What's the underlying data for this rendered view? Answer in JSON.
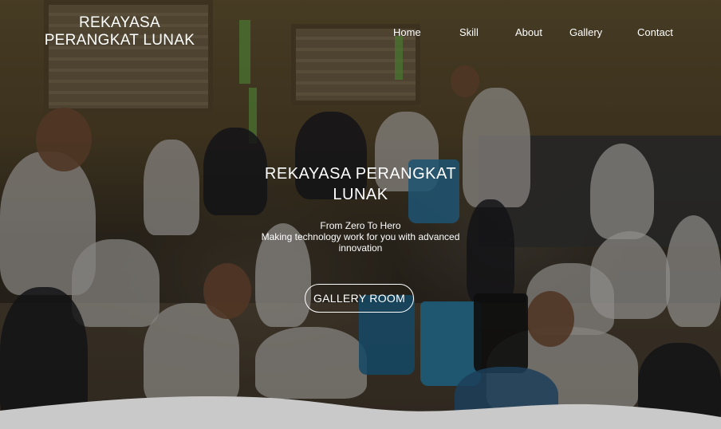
{
  "header": {
    "brand_title": "REKAYASA PERANGKAT LUNAK",
    "nav": [
      "Home",
      "Skill",
      "About",
      "Gallery",
      "Contact"
    ]
  },
  "hero": {
    "title": "REKAYASA PERANGKAT LUNAK",
    "tagline": "From Zero To Hero",
    "description": "Making technology work for you with advanced innovation",
    "button_label": "GALLERY ROOM"
  },
  "colors": {
    "text": "#ffffff",
    "wave": "#c9c9c9",
    "overlay": "rgba(0,0,0,0.34)"
  }
}
